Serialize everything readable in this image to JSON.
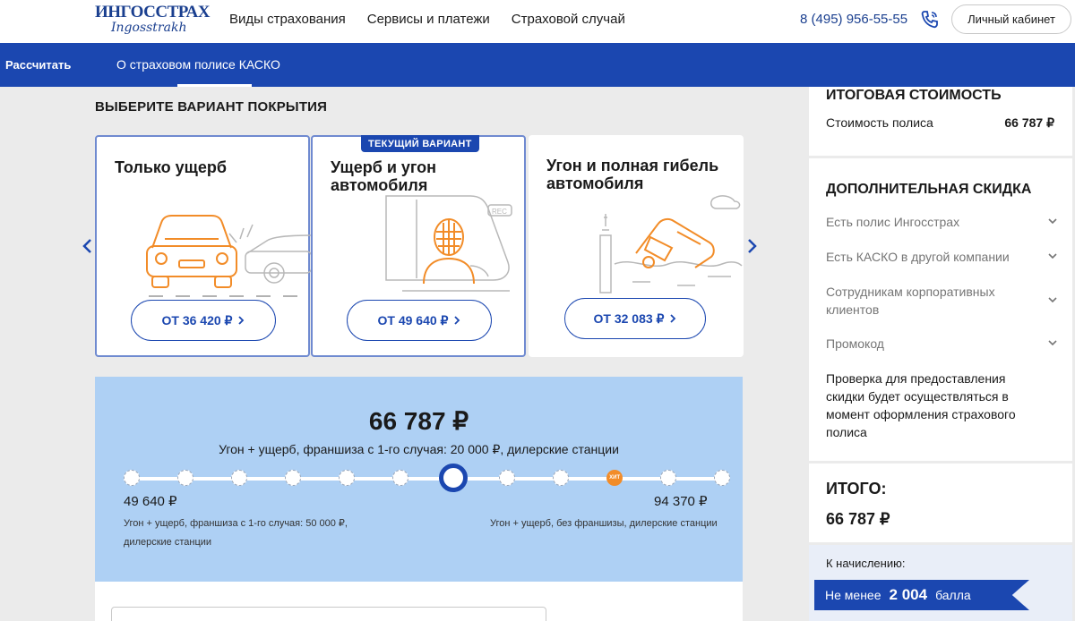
{
  "header": {
    "logo_line1": "ИНГОССТРАХ",
    "logo_line2": "Ingosstrakh",
    "nav": [
      "Виды страхования",
      "Сервисы и платежи",
      "Страховой случай"
    ],
    "phone": "8 (495) 956-55-55",
    "cabinet_label": "Личный кабинет"
  },
  "subbar": {
    "calc_label": "Рассчитать",
    "about_label": "О страховом полисе КАСКО"
  },
  "coverage": {
    "title": "ВЫБЕРИТЕ ВАРИАНТ ПОКРЫТИЯ",
    "badge": "ТЕКУЩИЙ ВАРИАНТ",
    "cards": [
      {
        "title": "Только ущерб",
        "price": "ОТ 36 420 ₽",
        "icon": "car-damage-illustration"
      },
      {
        "title": "Ущерб и угон автомобиля",
        "price": "ОТ 49 640 ₽",
        "icon": "car-theft-illustration"
      },
      {
        "title": "Угон и полная гибель автомобиля",
        "price": "ОТ 32 083 ₽",
        "icon": "car-total-loss-illustration"
      }
    ],
    "selected_index": 1
  },
  "price": {
    "total": "66 787 ₽",
    "description": "Угон + ущерб, франшиза с 1-го случая: 20 000 ₽, дилерские станции",
    "min_price": "49 640 ₽",
    "max_price": "94 370 ₽",
    "min_note": "Угон + ущерб, франшиза с 1-го случая: 50 000 ₽, дилерские станции",
    "max_note": "Угон + ущерб, без франшизы, дилерские станции",
    "hit_label": "ХИТ",
    "slider_steps": 12,
    "slider_active_index": 6,
    "slider_hit_index": 9
  },
  "summary": {
    "title": "ИТОГОВАЯ СТОИМОСТЬ",
    "policy_label": "Стоимость полиса",
    "policy_value": "66 787 ₽",
    "discount_title": "ДОПОЛНИТЕЛЬНАЯ СКИДКА",
    "discounts": [
      "Есть полис Ингосстрах",
      "Есть КАСКО в другой компании",
      "Сотрудникам корпоративных клиентов",
      "Промокод"
    ],
    "note": "Проверка для предоставления скидки будет осуществляться в момент оформления страхового полиса",
    "total_title": "ИТОГО:",
    "total_value": "66 787 ₽",
    "accrual_label": "К начислению:",
    "points_prefix": "Не менее",
    "points_value": "2 004",
    "points_suffix": "балла"
  },
  "colors": {
    "brand_blue": "#1b47b0",
    "price_panel": "#aed0f4",
    "illustration_orange": "#f28c28"
  }
}
